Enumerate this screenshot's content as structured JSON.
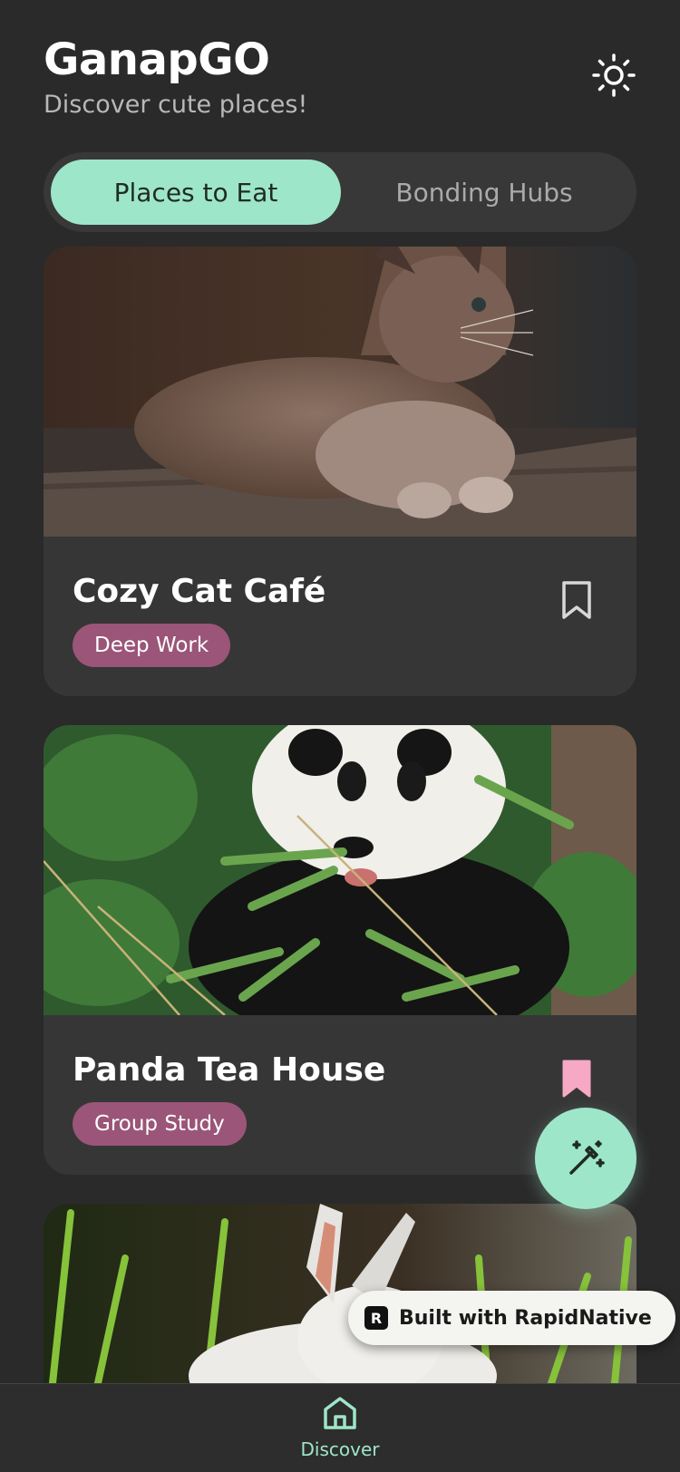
{
  "header": {
    "title": "GanapGO",
    "subtitle": "Discover cute places!",
    "theme_icon": "sun-icon"
  },
  "tabs": [
    {
      "label": "Places to Eat",
      "active": true
    },
    {
      "label": "Bonding Hubs",
      "active": false
    }
  ],
  "places": [
    {
      "name": "Cozy Cat Café",
      "tag": "Deep Work",
      "bookmarked": false,
      "image": "cat-photo"
    },
    {
      "name": "Panda Tea House",
      "tag": "Group Study",
      "bookmarked": true,
      "image": "panda-photo"
    },
    {
      "name": "",
      "tag": "",
      "bookmarked": false,
      "image": "rabbit-photo"
    }
  ],
  "fab": {
    "icon": "magic-wand-icon"
  },
  "badge": {
    "label": "Built with RapidNative"
  },
  "bottom_nav": {
    "items": [
      {
        "label": "Discover",
        "icon": "home-icon",
        "active": true
      }
    ]
  },
  "colors": {
    "accent": "#9ee6c9",
    "tag": "#9a5578",
    "bookmark_active": "#f7a8c4",
    "background": "#2a2a2a"
  }
}
